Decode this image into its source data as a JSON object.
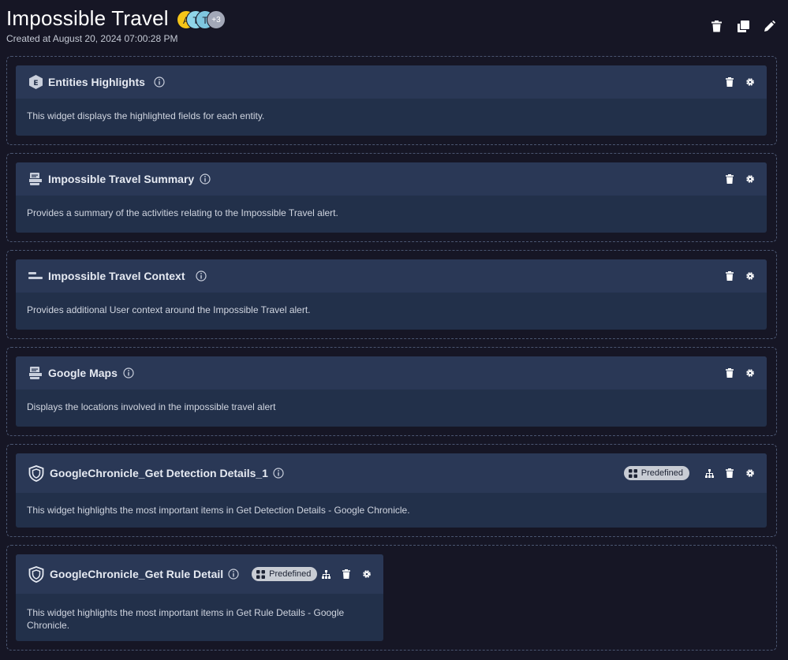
{
  "header": {
    "title": "Impossible Travel",
    "created": "Created at August 20, 2024 07:00:28 PM",
    "avatars": [
      {
        "letter": "A",
        "color": "#f5c518"
      },
      {
        "letter": "T",
        "color": "#8fd4e8"
      },
      {
        "letter": "T",
        "color": "#7ec6df"
      },
      {
        "letter": "+3",
        "color": "#a3a8b8"
      }
    ],
    "actions": [
      "trash-icon",
      "copy-icon",
      "pencil-icon"
    ]
  },
  "widgets": [
    {
      "title": "Entities Highlights",
      "description": "This widget displays the highlighted fields for each entity.",
      "icon": "entity-icon"
    },
    {
      "title": "Impossible Travel Summary",
      "description": "Provides a summary of the activities relating to the Impossible Travel alert.",
      "icon": "html-icon"
    },
    {
      "title": "Impossible Travel Context",
      "description": "Provides additional User context around the Impossible Travel alert.",
      "icon": "text-lines-icon"
    },
    {
      "title": "Google Maps",
      "description": "Displays the locations involved in the impossible travel alert",
      "icon": "html-icon"
    },
    {
      "title": "GoogleChronicle_Get Detection Details_1",
      "description": "This widget highlights the most important items in Get Detection Details - Google Chronicle.",
      "icon": "shield-icon",
      "badge": "Predefined"
    },
    {
      "title": "GoogleChronicle_Get Rule Detail",
      "description": "This widget highlights the most important items in Get Rule Details - Google Chronicle.",
      "icon": "shield-icon",
      "badge": "Predefined"
    }
  ],
  "colors": {
    "background": "#161625",
    "widget": "#22304a",
    "widget_header": "#2a3856",
    "border": "#4a5570"
  }
}
